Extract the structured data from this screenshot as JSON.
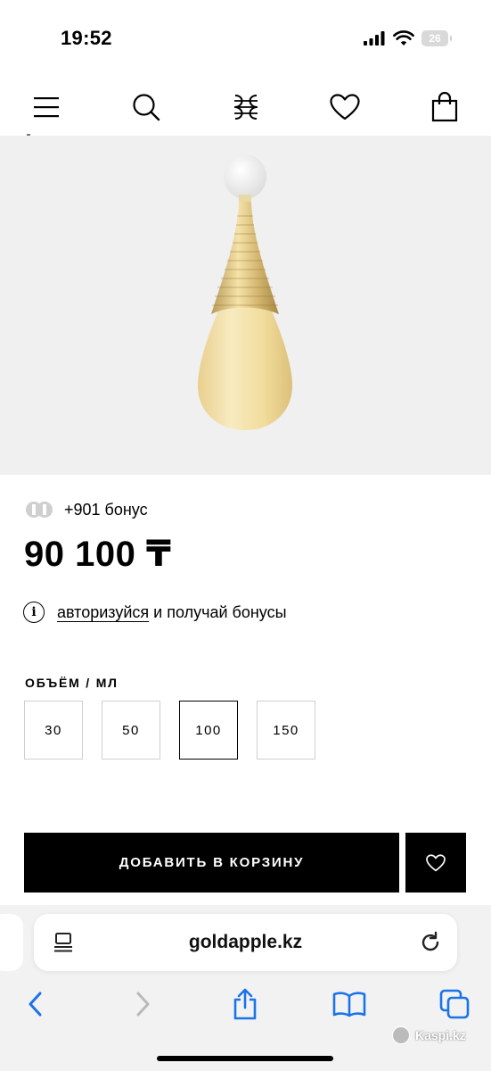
{
  "status": {
    "time": "19:52",
    "battery": "26"
  },
  "nav": {
    "items": [
      "menu-icon",
      "search-icon",
      "logo-icon",
      "heart-icon",
      "bag-icon"
    ]
  },
  "product": {
    "bonus_text": "+901 бонус",
    "price": "90 100 ₸",
    "auth_link": "авторизуйся",
    "auth_rest": "и получай бонусы",
    "info_symbol": "i",
    "volume_title": "ОБЪЁМ / МЛ",
    "volumes": [
      "30",
      "50",
      "100",
      "150"
    ],
    "selected_volume": "100",
    "add_to_cart": "ДОБАВИТЬ В КОРЗИНУ"
  },
  "browser": {
    "url": "goldapple.kz",
    "toolbar": [
      "back-icon",
      "forward-icon",
      "share-icon",
      "bookmarks-icon",
      "tabs-icon"
    ]
  },
  "watermark": "Kaspi.kz",
  "colors": {
    "accent": "#000000",
    "link_blue": "#1a73e8",
    "image_bg": "#f0f0f0"
  }
}
